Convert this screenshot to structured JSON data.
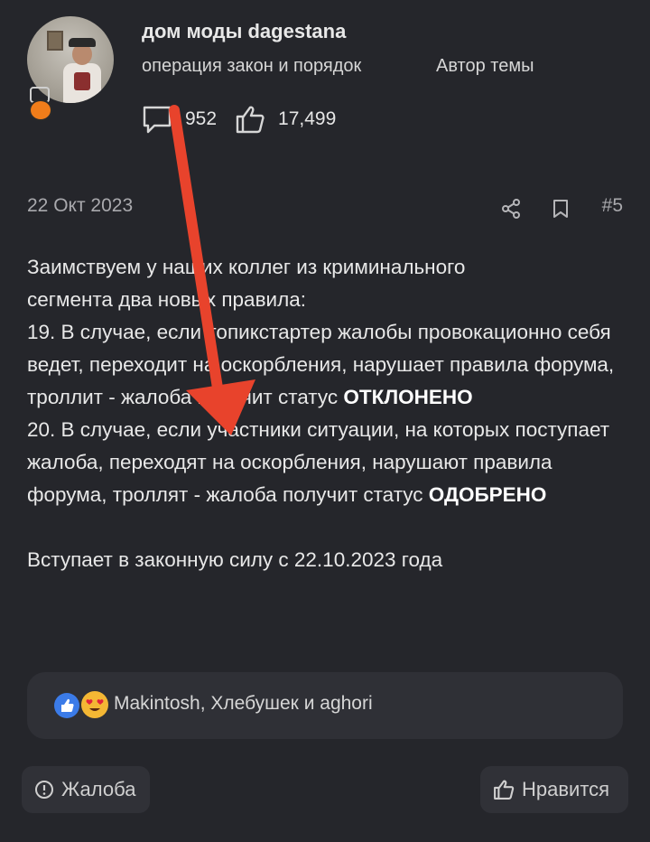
{
  "profile": {
    "username": "дом моды dagestana",
    "title": "операция закон и порядок",
    "author_tag": "Автор темы",
    "messages_count": "952",
    "reactions_count": "17,499"
  },
  "post": {
    "date": "22 Окт 2023",
    "number": "#5",
    "line1": "Заимствуем у наших коллег из криминального",
    "line2": "сегмента два новых правила:",
    "rule19_text": "19. В случае, если топикстартер жалобы провокационно себя ведет, переходит на оскорбления, нарушает правила форума, троллит - жалоба получит статус ",
    "rule19_status": "ОТКЛОНЕНО",
    "rule20_text": "20. В случае, если участники ситуации, на которых поступает жалоба, переходят на оскорбления, нарушают правила форума, троллят - жалоба получит статус ",
    "rule20_status": "ОДОБРЕНО",
    "effective": "Вступает в законную силу с 22.10.2023 года"
  },
  "reactions_bar": {
    "text": "Makintosh, Хлебушек и aghori"
  },
  "actions": {
    "report_label": "Жалоба",
    "like_label": "Нравится"
  },
  "colors": {
    "background": "#25262b",
    "arrow": "#e8432c",
    "like_reaction": "#3b7be8"
  }
}
